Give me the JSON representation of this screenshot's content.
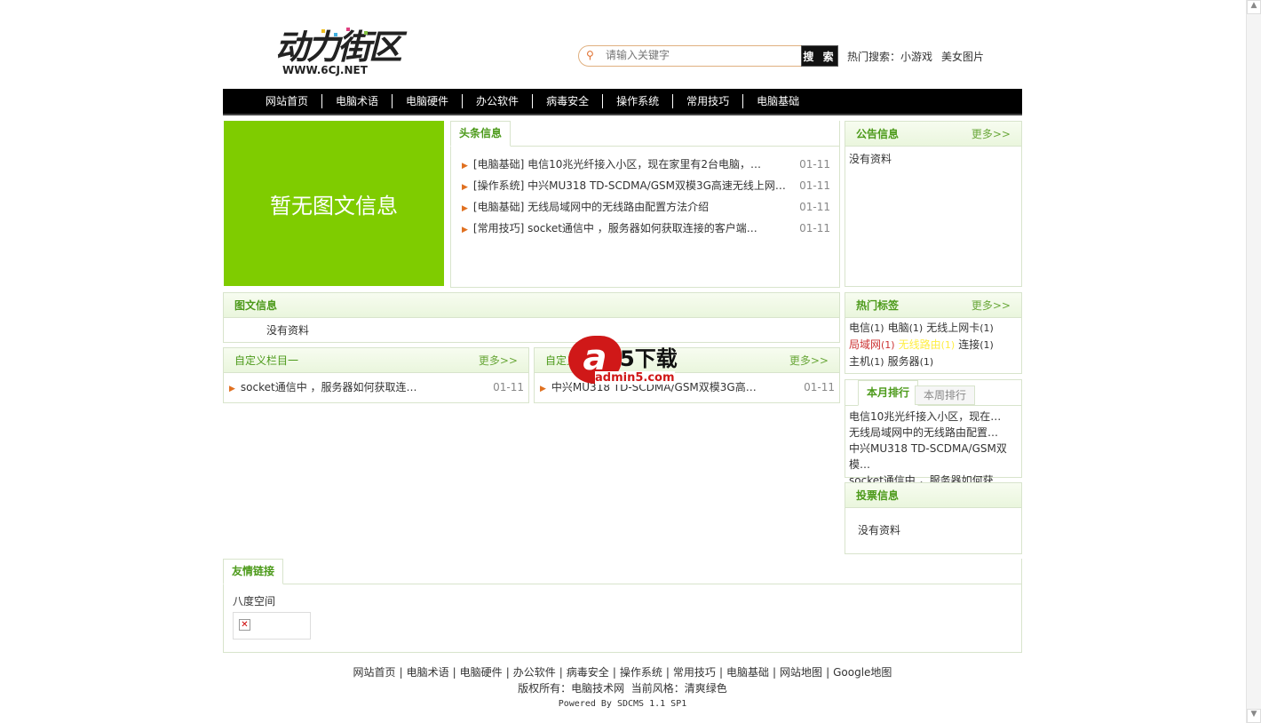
{
  "header": {
    "logo_text": "动力街区",
    "logo_url": "WWW.6CJ.NET",
    "search_placeholder": "请输入关键字",
    "search_button": "搜 索",
    "hot_label": "热门搜索：",
    "hot_items": [
      "小游戏",
      "美女图片"
    ]
  },
  "nav": [
    "网站首页",
    "电脑术语",
    "电脑硬件",
    "办公软件",
    "病毒安全",
    "操作系统",
    "常用技巧",
    "电脑基础"
  ],
  "no_pic": "暂无图文信息",
  "headlines": {
    "title": "头条信息",
    "items": [
      {
        "text": "[电脑基础] 电信10兆光纤接入小区，现在家里有2台电脑，…",
        "date": "01-11"
      },
      {
        "text": "[操作系统] 中兴MU318 TD-SCDMA/GSM双模3G高速无线上网…",
        "date": "01-11"
      },
      {
        "text": "[电脑基础] 无线局域网中的无线路由配置方法介绍",
        "date": "01-11"
      },
      {
        "text": "[常用技巧] socket通信中 ，服务器如何获取连接的客户端…",
        "date": "01-11"
      }
    ]
  },
  "notice": {
    "title": "公告信息",
    "more": "更多>>",
    "empty": "没有资料"
  },
  "picinfo": {
    "title": "图文信息",
    "empty": "没有资料"
  },
  "col1": {
    "title": "自定义栏目一",
    "more": "更多>>",
    "items": [
      {
        "text": "socket通信中 ，服务器如何获取连…",
        "date": "01-11"
      }
    ]
  },
  "col2": {
    "title": "自定义栏目二",
    "more": "更多>>",
    "items": [
      {
        "text": "中兴MU318 TD-SCDMA/GSM双模3G高…",
        "date": "01-11"
      }
    ]
  },
  "tags": {
    "title": "热门标签",
    "more": "更多>>",
    "items": [
      {
        "name": "电信",
        "count": "(1)",
        "color": "#333333"
      },
      {
        "name": "电脑",
        "count": "(1)",
        "color": "#333333"
      },
      {
        "name": "无线上网卡",
        "count": "(1)",
        "color": "#333333"
      },
      {
        "name": "局域网",
        "count": "(1)",
        "color": "#cc3333"
      },
      {
        "name": "无线路由",
        "count": "(1)",
        "color": "#ffee44"
      },
      {
        "name": "连接",
        "count": "(1)",
        "color": "#333333"
      },
      {
        "name": "主机",
        "count": "(1)",
        "color": "#333333"
      },
      {
        "name": "服务器",
        "count": "(1)",
        "color": "#333333"
      }
    ]
  },
  "rank": {
    "tab_month": "本月排行",
    "tab_week": "本周排行",
    "items": [
      "电信10兆光纤接入小区，现在…",
      "无线局域网中的无线路由配置…",
      "中兴MU318 TD-SCDMA/GSM双模…",
      "socket通信中 ，服务器如何获…"
    ]
  },
  "vote": {
    "title": "投票信息",
    "empty": "没有资料"
  },
  "links": {
    "title": "友情链接",
    "item": "八度空间"
  },
  "footer": {
    "links": [
      "网站首页",
      "电脑术语",
      "电脑硬件",
      "办公软件",
      "病毒安全",
      "操作系统",
      "常用技巧",
      "电脑基础",
      "网站地图",
      "Google地图"
    ],
    "copyright": "版权所有：电脑技术网  当前风格：清爽绿色",
    "powered": "Powered By SDCMS 1.1 SP1"
  },
  "watermark": {
    "brand": "a5下载",
    "url": "admin5.com"
  }
}
